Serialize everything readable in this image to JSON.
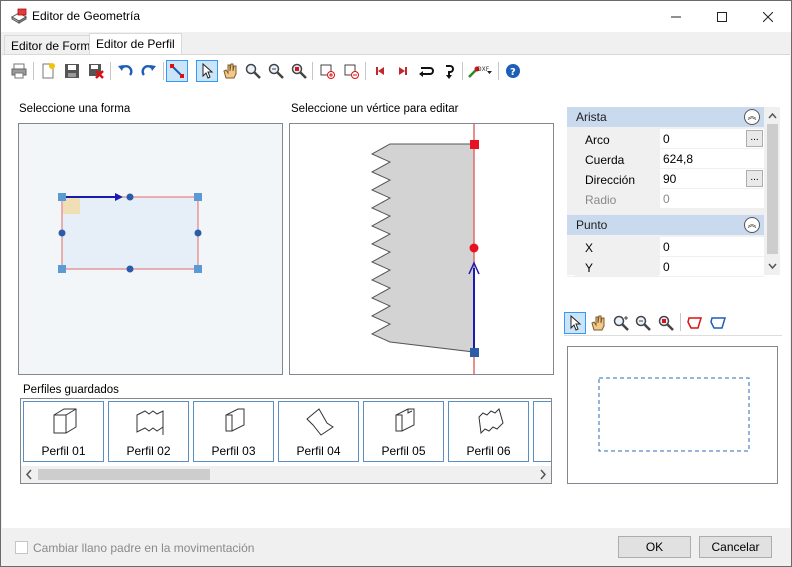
{
  "window": {
    "title": "Editor de Geometría"
  },
  "tabs": [
    {
      "label": "Editor de Forma",
      "active": false
    },
    {
      "label": "Editor de Perfil",
      "active": true
    }
  ],
  "toolbar": {
    "icons": [
      "print-icon",
      "new-icon",
      "save-icon",
      "delete-icon",
      "undo-icon",
      "redo-icon",
      "draw-edge-icon",
      "select-pointer-icon",
      "pan-hand-icon",
      "zoom-icon",
      "zoom-fit-icon",
      "zoom-window-icon",
      "add-vertex-icon",
      "remove-vertex-icon",
      "first-icon",
      "last-icon",
      "reverse-icon",
      "flip-icon",
      "dxf-import-icon",
      "help-icon"
    ],
    "dxf_label": "DXF"
  },
  "shape_panel": {
    "label": "Seleccione una forma"
  },
  "vertex_panel": {
    "label": "Seleccione un vértice para editar"
  },
  "properties": {
    "arista": {
      "title": "Arista",
      "rows": [
        {
          "name": "Arco",
          "value": "0",
          "has_button": true
        },
        {
          "name": "Cuerda",
          "value": "624,8",
          "has_button": false
        },
        {
          "name": "Dirección",
          "value": "90",
          "has_button": true
        },
        {
          "name": "Radio",
          "value": "0",
          "has_button": false,
          "disabled": true
        }
      ]
    },
    "punto": {
      "title": "Punto",
      "rows": [
        {
          "name": "X",
          "value": "0"
        },
        {
          "name": "Y",
          "value": "0"
        }
      ]
    },
    "ellipsis": "..."
  },
  "preview_toolbar": {
    "icons": [
      "select-pointer-icon",
      "pan-hand-icon",
      "zoom-in-icon",
      "zoom-out-icon",
      "zoom-fit-icon",
      "polygon-red-icon",
      "polygon-blue-icon"
    ]
  },
  "saved_profiles": {
    "label": "Perfiles guardados",
    "items": [
      "Perfil 01",
      "Perfil 02",
      "Perfil 03",
      "Perfil 04",
      "Perfil 05",
      "Perfil 06"
    ]
  },
  "footer": {
    "checkbox_label": "Cambiar llano padre en la movimentación",
    "checkbox_checked": false,
    "ok_label": "OK",
    "cancel_label": "Cancelar"
  },
  "colors": {
    "accent": "#0078d7",
    "category_bg": "#c9d9ee",
    "selection_red": "#e81123",
    "vertex_blue": "#2a5caa"
  }
}
